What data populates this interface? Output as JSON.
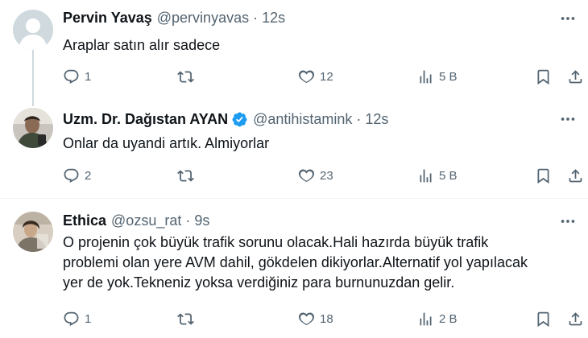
{
  "tweets": [
    {
      "name": "Pervin Yavaş",
      "handle": "@pervinyavas",
      "separator": "·",
      "time": "12s",
      "verified": false,
      "lines": [
        "Araplar satın alır sadece"
      ],
      "replies": "1",
      "retweets": "",
      "likes": "12",
      "views": "5 B"
    },
    {
      "name": "Uzm. Dr. Dağıstan AYAN",
      "handle": "@antihistamink",
      "separator": "·",
      "time": "12s",
      "verified": true,
      "lines": [
        "Onlar da uyandi artık. Almiyorlar"
      ],
      "replies": "2",
      "retweets": "",
      "likes": "23",
      "views": "5 B"
    },
    {
      "name": "Ethica",
      "handle": "@ozsu_rat",
      "separator": "·",
      "time": "9s",
      "verified": false,
      "lines": [
        "O projenin çok büyük trafik sorunu olacak.Hali hazırda büyük trafik",
        "problemi olan yere AVM dahil, gökdelen dikiyorlar.Alternatif yol yapılacak",
        "yer de yok.Tekneniz yoksa verdiğiniz para burnunuzdan gelir."
      ],
      "replies": "1",
      "retweets": "",
      "likes": "18",
      "views": "2 B"
    }
  ],
  "colors": {
    "text": "#0f1419",
    "secondary": "#536471",
    "verified": "#1d9bf0",
    "thread_line": "#cfd9de",
    "divider": "#eff3f4"
  },
  "icons": {
    "reply": "reply-icon",
    "retweet": "retweet-icon",
    "like": "heart-icon",
    "views": "views-icon",
    "bookmark": "bookmark-icon",
    "share": "share-icon",
    "more": "more-options-icon",
    "verified": "verified-badge-icon"
  }
}
